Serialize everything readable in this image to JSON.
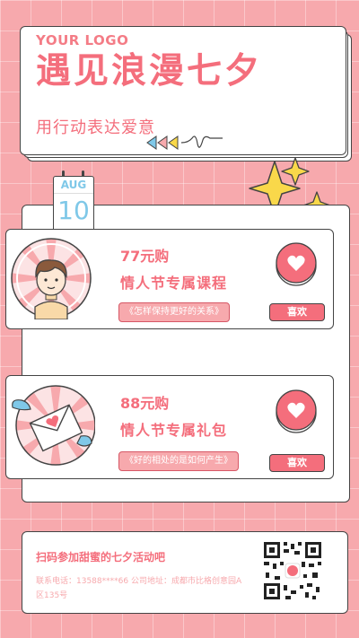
{
  "header": {
    "logo_text": "YOUR LOGO",
    "title": "遇见浪漫七夕",
    "subtitle": "用行动表达爱意"
  },
  "calendar": {
    "month": "AUG",
    "day": "10"
  },
  "products": [
    {
      "price": "77元购",
      "name": "情人节专属课程",
      "quote": "《怎样保持更好的关系》",
      "like_label": "喜欢"
    },
    {
      "price": "88元购",
      "name": "情人节专属礼包",
      "quote": "《好的相处的是如何产生》",
      "like_label": "喜欢"
    }
  ],
  "footer": {
    "title": "扫码参加甜蜜的七夕活动吧",
    "info": "联系电话：13588****66 公司地址：成都市比格创意园A区135号"
  },
  "colors": {
    "accent": "#f46e7c",
    "background": "#f7a9ad",
    "star": "#f9d84a"
  }
}
